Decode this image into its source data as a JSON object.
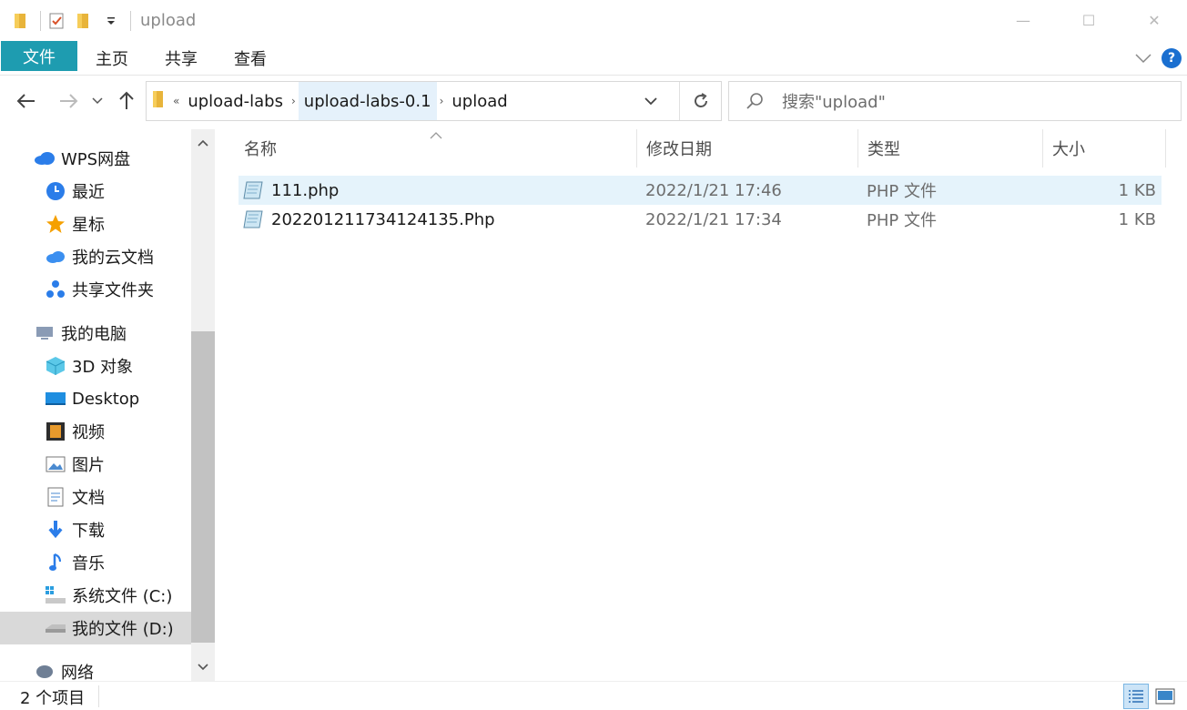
{
  "titlebar": {
    "title": "upload",
    "min": "—",
    "max": "☐",
    "close": "✕"
  },
  "ribbon": {
    "tabs": [
      "文件",
      "主页",
      "共享",
      "查看"
    ],
    "help": "?"
  },
  "address": {
    "overflow": "«",
    "crumbs": [
      "upload-labs",
      "upload-labs-0.1",
      "upload"
    ]
  },
  "search": {
    "placeholder": "搜索\"upload\""
  },
  "sidebar": {
    "items": [
      {
        "label": "WPS网盘",
        "icon": "cloud-icon"
      },
      {
        "label": "最近",
        "icon": "clock-icon"
      },
      {
        "label": "星标",
        "icon": "star-icon"
      },
      {
        "label": "我的云文档",
        "icon": "cloud-doc-icon"
      },
      {
        "label": "共享文件夹",
        "icon": "share-icon"
      },
      {
        "label": "我的电脑",
        "icon": "computer-icon"
      },
      {
        "label": "3D 对象",
        "icon": "cube-icon"
      },
      {
        "label": "Desktop",
        "icon": "desktop-icon"
      },
      {
        "label": "视频",
        "icon": "video-icon"
      },
      {
        "label": "图片",
        "icon": "picture-icon"
      },
      {
        "label": "文档",
        "icon": "document-icon"
      },
      {
        "label": "下载",
        "icon": "download-icon"
      },
      {
        "label": "音乐",
        "icon": "music-icon"
      },
      {
        "label": "系统文件 (C:)",
        "icon": "drive-c-icon"
      },
      {
        "label": "我的文件 (D:)",
        "icon": "drive-d-icon"
      },
      {
        "label": "网络",
        "icon": "network-icon"
      }
    ]
  },
  "columns": {
    "name": "名称",
    "date": "修改日期",
    "type": "类型",
    "size": "大小"
  },
  "files": [
    {
      "name": "111.php",
      "date": "2022/1/21 17:46",
      "type": "PHP 文件",
      "size": "1 KB"
    },
    {
      "name": "20220121173412413​5.Php",
      "date": "2022/1/21 17:34",
      "type": "PHP 文件",
      "size": "1 KB"
    }
  ],
  "status": {
    "count": "2 个项目"
  },
  "colors": {
    "accent": "#1e9cb0",
    "selection": "#e5f3fb",
    "help": "#1a6fd0"
  }
}
